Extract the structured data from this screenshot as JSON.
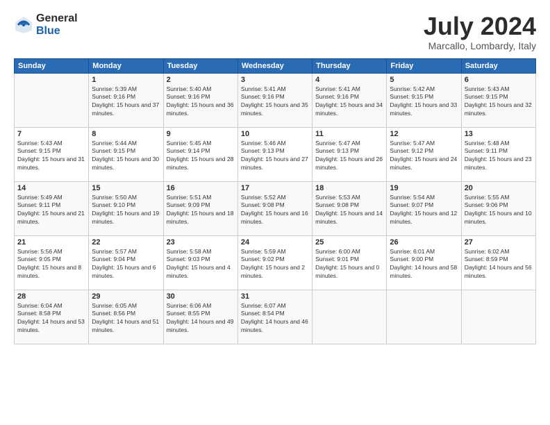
{
  "header": {
    "logo_general": "General",
    "logo_blue": "Blue",
    "month_year": "July 2024",
    "location": "Marcallo, Lombardy, Italy"
  },
  "weekdays": [
    "Sunday",
    "Monday",
    "Tuesday",
    "Wednesday",
    "Thursday",
    "Friday",
    "Saturday"
  ],
  "weeks": [
    [
      {
        "day": "",
        "sunrise": "",
        "sunset": "",
        "daylight": ""
      },
      {
        "day": "1",
        "sunrise": "Sunrise: 5:39 AM",
        "sunset": "Sunset: 9:16 PM",
        "daylight": "Daylight: 15 hours and 37 minutes."
      },
      {
        "day": "2",
        "sunrise": "Sunrise: 5:40 AM",
        "sunset": "Sunset: 9:16 PM",
        "daylight": "Daylight: 15 hours and 36 minutes."
      },
      {
        "day": "3",
        "sunrise": "Sunrise: 5:41 AM",
        "sunset": "Sunset: 9:16 PM",
        "daylight": "Daylight: 15 hours and 35 minutes."
      },
      {
        "day": "4",
        "sunrise": "Sunrise: 5:41 AM",
        "sunset": "Sunset: 9:16 PM",
        "daylight": "Daylight: 15 hours and 34 minutes."
      },
      {
        "day": "5",
        "sunrise": "Sunrise: 5:42 AM",
        "sunset": "Sunset: 9:15 PM",
        "daylight": "Daylight: 15 hours and 33 minutes."
      },
      {
        "day": "6",
        "sunrise": "Sunrise: 5:43 AM",
        "sunset": "Sunset: 9:15 PM",
        "daylight": "Daylight: 15 hours and 32 minutes."
      }
    ],
    [
      {
        "day": "7",
        "sunrise": "Sunrise: 5:43 AM",
        "sunset": "Sunset: 9:15 PM",
        "daylight": "Daylight: 15 hours and 31 minutes."
      },
      {
        "day": "8",
        "sunrise": "Sunrise: 5:44 AM",
        "sunset": "Sunset: 9:15 PM",
        "daylight": "Daylight: 15 hours and 30 minutes."
      },
      {
        "day": "9",
        "sunrise": "Sunrise: 5:45 AM",
        "sunset": "Sunset: 9:14 PM",
        "daylight": "Daylight: 15 hours and 28 minutes."
      },
      {
        "day": "10",
        "sunrise": "Sunrise: 5:46 AM",
        "sunset": "Sunset: 9:13 PM",
        "daylight": "Daylight: 15 hours and 27 minutes."
      },
      {
        "day": "11",
        "sunrise": "Sunrise: 5:47 AM",
        "sunset": "Sunset: 9:13 PM",
        "daylight": "Daylight: 15 hours and 26 minutes."
      },
      {
        "day": "12",
        "sunrise": "Sunrise: 5:47 AM",
        "sunset": "Sunset: 9:12 PM",
        "daylight": "Daylight: 15 hours and 24 minutes."
      },
      {
        "day": "13",
        "sunrise": "Sunrise: 5:48 AM",
        "sunset": "Sunset: 9:11 PM",
        "daylight": "Daylight: 15 hours and 23 minutes."
      }
    ],
    [
      {
        "day": "14",
        "sunrise": "Sunrise: 5:49 AM",
        "sunset": "Sunset: 9:11 PM",
        "daylight": "Daylight: 15 hours and 21 minutes."
      },
      {
        "day": "15",
        "sunrise": "Sunrise: 5:50 AM",
        "sunset": "Sunset: 9:10 PM",
        "daylight": "Daylight: 15 hours and 19 minutes."
      },
      {
        "day": "16",
        "sunrise": "Sunrise: 5:51 AM",
        "sunset": "Sunset: 9:09 PM",
        "daylight": "Daylight: 15 hours and 18 minutes."
      },
      {
        "day": "17",
        "sunrise": "Sunrise: 5:52 AM",
        "sunset": "Sunset: 9:08 PM",
        "daylight": "Daylight: 15 hours and 16 minutes."
      },
      {
        "day": "18",
        "sunrise": "Sunrise: 5:53 AM",
        "sunset": "Sunset: 9:08 PM",
        "daylight": "Daylight: 15 hours and 14 minutes."
      },
      {
        "day": "19",
        "sunrise": "Sunrise: 5:54 AM",
        "sunset": "Sunset: 9:07 PM",
        "daylight": "Daylight: 15 hours and 12 minutes."
      },
      {
        "day": "20",
        "sunrise": "Sunrise: 5:55 AM",
        "sunset": "Sunset: 9:06 PM",
        "daylight": "Daylight: 15 hours and 10 minutes."
      }
    ],
    [
      {
        "day": "21",
        "sunrise": "Sunrise: 5:56 AM",
        "sunset": "Sunset: 9:05 PM",
        "daylight": "Daylight: 15 hours and 8 minutes."
      },
      {
        "day": "22",
        "sunrise": "Sunrise: 5:57 AM",
        "sunset": "Sunset: 9:04 PM",
        "daylight": "Daylight: 15 hours and 6 minutes."
      },
      {
        "day": "23",
        "sunrise": "Sunrise: 5:58 AM",
        "sunset": "Sunset: 9:03 PM",
        "daylight": "Daylight: 15 hours and 4 minutes."
      },
      {
        "day": "24",
        "sunrise": "Sunrise: 5:59 AM",
        "sunset": "Sunset: 9:02 PM",
        "daylight": "Daylight: 15 hours and 2 minutes."
      },
      {
        "day": "25",
        "sunrise": "Sunrise: 6:00 AM",
        "sunset": "Sunset: 9:01 PM",
        "daylight": "Daylight: 15 hours and 0 minutes."
      },
      {
        "day": "26",
        "sunrise": "Sunrise: 6:01 AM",
        "sunset": "Sunset: 9:00 PM",
        "daylight": "Daylight: 14 hours and 58 minutes."
      },
      {
        "day": "27",
        "sunrise": "Sunrise: 6:02 AM",
        "sunset": "Sunset: 8:59 PM",
        "daylight": "Daylight: 14 hours and 56 minutes."
      }
    ],
    [
      {
        "day": "28",
        "sunrise": "Sunrise: 6:04 AM",
        "sunset": "Sunset: 8:58 PM",
        "daylight": "Daylight: 14 hours and 53 minutes."
      },
      {
        "day": "29",
        "sunrise": "Sunrise: 6:05 AM",
        "sunset": "Sunset: 8:56 PM",
        "daylight": "Daylight: 14 hours and 51 minutes."
      },
      {
        "day": "30",
        "sunrise": "Sunrise: 6:06 AM",
        "sunset": "Sunset: 8:55 PM",
        "daylight": "Daylight: 14 hours and 49 minutes."
      },
      {
        "day": "31",
        "sunrise": "Sunrise: 6:07 AM",
        "sunset": "Sunset: 8:54 PM",
        "daylight": "Daylight: 14 hours and 46 minutes."
      },
      {
        "day": "",
        "sunrise": "",
        "sunset": "",
        "daylight": ""
      },
      {
        "day": "",
        "sunrise": "",
        "sunset": "",
        "daylight": ""
      },
      {
        "day": "",
        "sunrise": "",
        "sunset": "",
        "daylight": ""
      }
    ]
  ]
}
